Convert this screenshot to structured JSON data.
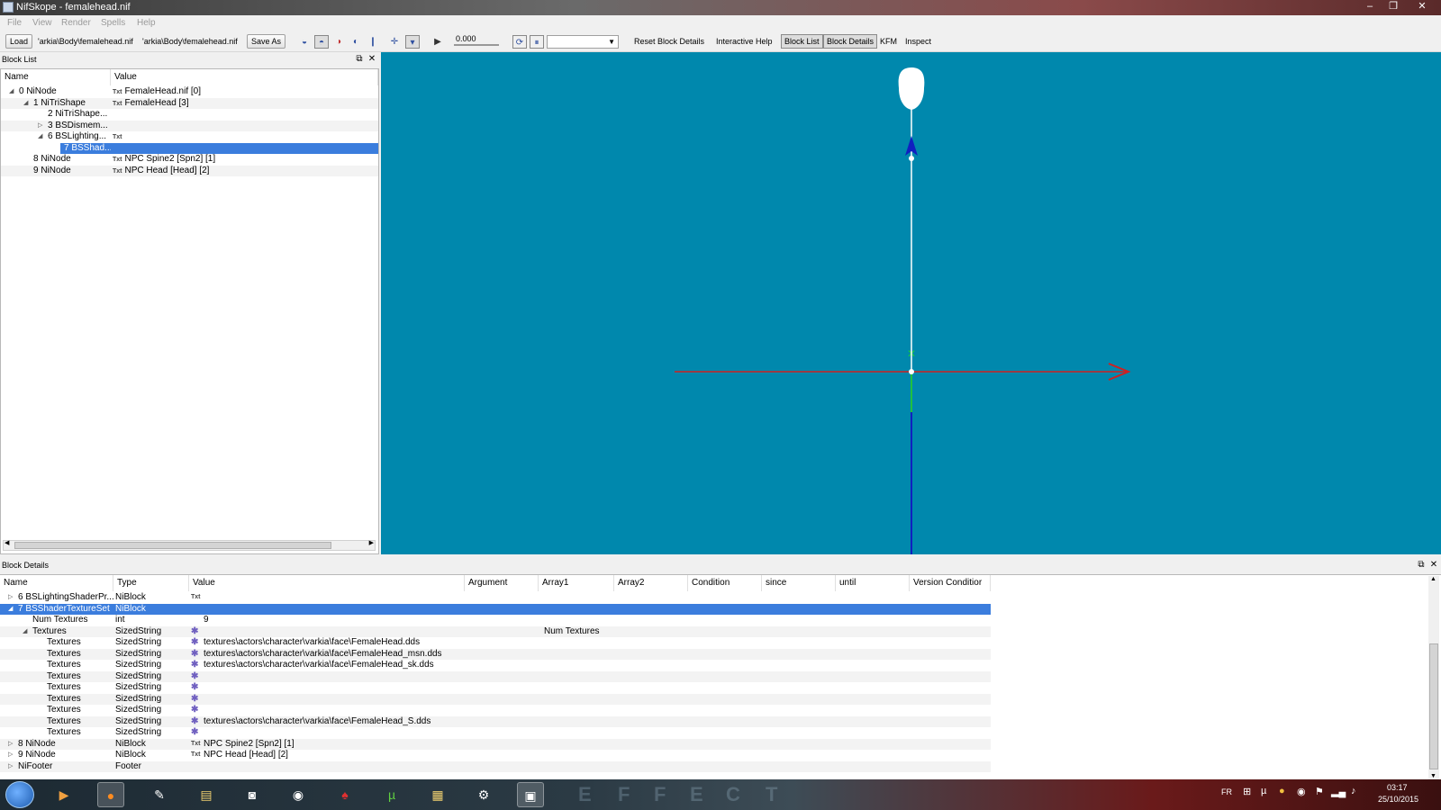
{
  "window": {
    "title": "NifSkope - femalehead.nif",
    "min": "–",
    "max": "❐",
    "close": "✕"
  },
  "menu": [
    "File",
    "View",
    "Render",
    "Spells",
    "Help"
  ],
  "toolbar": {
    "load": "Load",
    "path1": "'arkia\\Body\\femalehead.nif",
    "path2": "'arkia\\Body\\femalehead.nif",
    "save_as": "Save As",
    "time_value": "0.000",
    "reset_block_details": "Reset Block Details",
    "interactive_help": "Interactive Help",
    "block_list": "Block List",
    "block_details": "Block Details",
    "kfm": "KFM",
    "inspect": "Inspect"
  },
  "blocklist": {
    "title": "Block List",
    "columns": [
      "Name",
      "Value"
    ],
    "rows": [
      {
        "indent": 0,
        "arrow": "◢",
        "name": "0 NiNode",
        "txt": "Txt",
        "value": "FemaleHead.nif [0]"
      },
      {
        "indent": 1,
        "arrow": "◢",
        "name": "1 NiTriShape",
        "txt": "Txt",
        "value": "FemaleHead [3]"
      },
      {
        "indent": 2,
        "arrow": "",
        "name": "2 NiTriShape...",
        "txt": "",
        "value": ""
      },
      {
        "indent": 2,
        "arrow": "▷",
        "name": "3 BSDismem...",
        "txt": "",
        "value": ""
      },
      {
        "indent": 2,
        "arrow": "◢",
        "name": "6 BSLighting...",
        "txt": "Txt",
        "value": ""
      },
      {
        "indent": 3,
        "arrow": "",
        "name": "7 BSShad...",
        "txt": "",
        "value": "",
        "selected": true
      },
      {
        "indent": 1,
        "arrow": "",
        "name": "8 NiNode",
        "txt": "Txt",
        "value": "NPC Spine2 [Spn2] [1]"
      },
      {
        "indent": 1,
        "arrow": "",
        "name": "9 NiNode",
        "txt": "Txt",
        "value": "NPC Head [Head] [2]"
      }
    ]
  },
  "details": {
    "title": "Block Details",
    "columns": [
      "Name",
      "Type",
      "Value",
      "Argument",
      "Array1",
      "Array2",
      "Condition",
      "since",
      "until",
      "Version Conditior"
    ],
    "rows": [
      {
        "indent": 0,
        "arrow": "▷",
        "name": "6 BSLightingShaderPr...",
        "type": "NiBlock",
        "icon": "Txt",
        "value": "",
        "array1": ""
      },
      {
        "indent": 0,
        "arrow": "◢",
        "name": "7 BSShaderTextureSet",
        "type": "NiBlock",
        "icon": "",
        "value": "",
        "array1": "",
        "selected": true
      },
      {
        "indent": 1,
        "arrow": "",
        "name": "Num Textures",
        "type": "int",
        "icon": "",
        "value": "9",
        "array1": ""
      },
      {
        "indent": 1,
        "arrow": "◢",
        "name": "Textures",
        "type": "SizedString",
        "icon": "✱",
        "value": "",
        "array1": "Num Textures"
      },
      {
        "indent": 2,
        "arrow": "",
        "name": "Textures",
        "type": "SizedString",
        "icon": "✱",
        "value": "textures\\actors\\character\\varkia\\face\\FemaleHead.dds",
        "array1": ""
      },
      {
        "indent": 2,
        "arrow": "",
        "name": "Textures",
        "type": "SizedString",
        "icon": "✱",
        "value": "textures\\actors\\character\\varkia\\face\\FemaleHead_msn.dds",
        "array1": ""
      },
      {
        "indent": 2,
        "arrow": "",
        "name": "Textures",
        "type": "SizedString",
        "icon": "✱",
        "value": "textures\\actors\\character\\varkia\\face\\FemaleHead_sk.dds",
        "array1": ""
      },
      {
        "indent": 2,
        "arrow": "",
        "name": "Textures",
        "type": "SizedString",
        "icon": "✱",
        "value": "",
        "array1": ""
      },
      {
        "indent": 2,
        "arrow": "",
        "name": "Textures",
        "type": "SizedString",
        "icon": "✱",
        "value": "",
        "array1": ""
      },
      {
        "indent": 2,
        "arrow": "",
        "name": "Textures",
        "type": "SizedString",
        "icon": "✱",
        "value": "",
        "array1": ""
      },
      {
        "indent": 2,
        "arrow": "",
        "name": "Textures",
        "type": "SizedString",
        "icon": "✱",
        "value": "",
        "array1": ""
      },
      {
        "indent": 2,
        "arrow": "",
        "name": "Textures",
        "type": "SizedString",
        "icon": "✱",
        "value": "textures\\actors\\character\\varkia\\face\\FemaleHead_S.dds",
        "array1": ""
      },
      {
        "indent": 2,
        "arrow": "",
        "name": "Textures",
        "type": "SizedString",
        "icon": "✱",
        "value": "",
        "array1": ""
      },
      {
        "indent": 0,
        "arrow": "▷",
        "name": "8 NiNode",
        "type": "NiBlock",
        "icon": "Txt",
        "value": "NPC Spine2 [Spn2] [1]",
        "array1": ""
      },
      {
        "indent": 0,
        "arrow": "▷",
        "name": "9 NiNode",
        "type": "NiBlock",
        "icon": "Txt",
        "value": "NPC Head [Head] [2]",
        "array1": ""
      },
      {
        "indent": 0,
        "arrow": "▷",
        "name": "NiFooter",
        "type": "Footer",
        "icon": "",
        "value": "",
        "array1": ""
      }
    ]
  },
  "viewport": {
    "background": "#0088ad"
  },
  "taskbar": {
    "apps": [
      "media-player",
      "firefox",
      "camera",
      "file-explorer",
      "screenshot",
      "steam",
      "adobe-flash",
      "utorrent",
      "game-manager",
      "settings",
      "virtual-machine"
    ],
    "wallpaper_text": [
      "E",
      "F",
      "F",
      "E",
      "C",
      "T"
    ],
    "language": "FR",
    "time": "03:17",
    "date": "25/10/2015"
  }
}
